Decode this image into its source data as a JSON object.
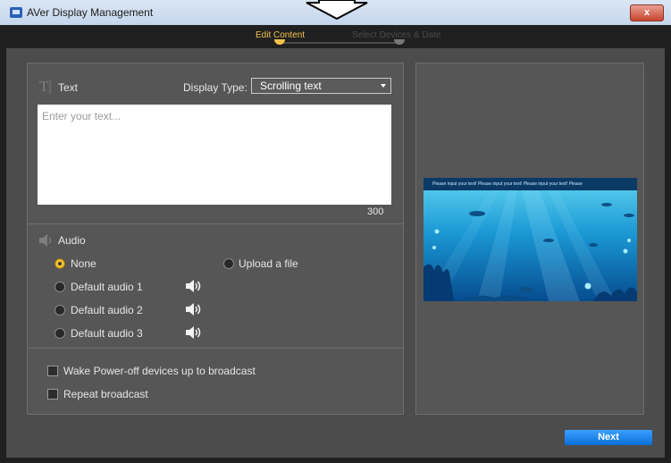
{
  "window": {
    "title": "AVer Display Management",
    "close_label": "x"
  },
  "steps": [
    {
      "label": "Edit Content"
    },
    {
      "label": "Select Devices & Date"
    }
  ],
  "text_section": {
    "label": "Text",
    "display_type_label": "Display Type:",
    "display_type_value": "Scrolling text",
    "placeholder": "Enter your text...",
    "char_count": "300"
  },
  "audio_section": {
    "label": "Audio",
    "options": [
      {
        "label": "None",
        "checked": true
      },
      {
        "label": "Upload a file",
        "checked": false
      },
      {
        "label": "Default audio 1",
        "checked": false
      },
      {
        "label": "Default audio 2",
        "checked": false
      },
      {
        "label": "Default audio 3",
        "checked": false
      }
    ]
  },
  "options_section": {
    "wake_label": "Wake Power-off devices up to broadcast",
    "wake_checked": false,
    "repeat_label": "Repeat broadcast",
    "repeat_checked": false
  },
  "preview": {
    "marquee_text": "Please input your text!   Please input your text!   Please input your text!   Please"
  },
  "footer": {
    "next_label": "Next"
  },
  "colors": {
    "accent": "#f3c24a",
    "button": "#1a86f0",
    "panel": "#565656",
    "background": "#4c4c4c"
  }
}
